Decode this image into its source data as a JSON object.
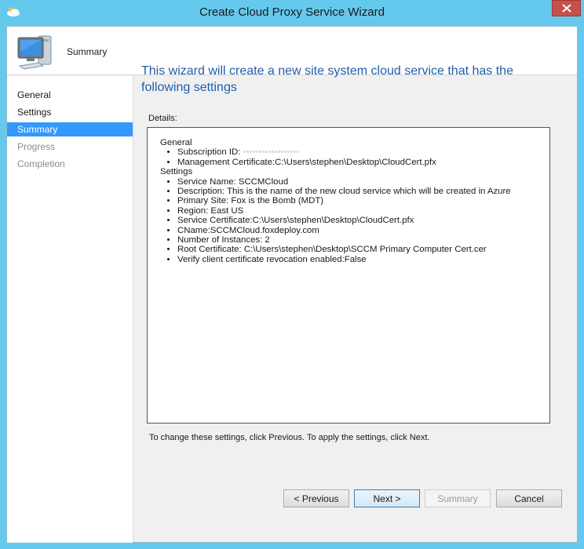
{
  "window": {
    "title": "Create Cloud Proxy Service Wizard"
  },
  "header": {
    "title": "Summary",
    "icon": "computer-monitor-icon"
  },
  "sidebar": {
    "items": [
      {
        "label": "General",
        "state": "normal"
      },
      {
        "label": "Settings",
        "state": "normal"
      },
      {
        "label": "Summary",
        "state": "active"
      },
      {
        "label": "Progress",
        "state": "disabled"
      },
      {
        "label": "Completion",
        "state": "disabled"
      }
    ]
  },
  "main": {
    "heading": "This wizard will create a new site system cloud service that has the following settings",
    "details_label": "Details:",
    "details": {
      "general_title": "General",
      "general_items": [
        "Subscription ID:",
        "Management Certificate:C:\\Users\\stephen\\Desktop\\CloudCert.pfx"
      ],
      "subscription_id_blurred": "••••••••••••••••••",
      "settings_title": "Settings",
      "settings_items": [
        "Service Name: SCCMCloud",
        "Description: This is the name of the new cloud service which will be created in Azure",
        "Primary Site: Fox is the Bomb (MDT)",
        "Region: East US",
        "Service Certificate:C:\\Users\\stephen\\Desktop\\CloudCert.pfx",
        "CName:SCCMCloud.foxdeploy.com",
        "Number of Instances: 2",
        "Root Certificate: C:\\Users\\stephen\\Desktop\\SCCM Primary Computer Cert.cer",
        "Verify client certificate revocation enabled:False"
      ]
    },
    "footer_note": "To change these settings, click Previous. To apply the settings, click Next."
  },
  "buttons": {
    "previous": "< Previous",
    "next": "Next >",
    "summary": "Summary",
    "cancel": "Cancel"
  },
  "colors": {
    "titlebar": "#65c9ee",
    "accent": "#3399ff",
    "heading": "#1e5fae",
    "close": "#c7504a"
  }
}
